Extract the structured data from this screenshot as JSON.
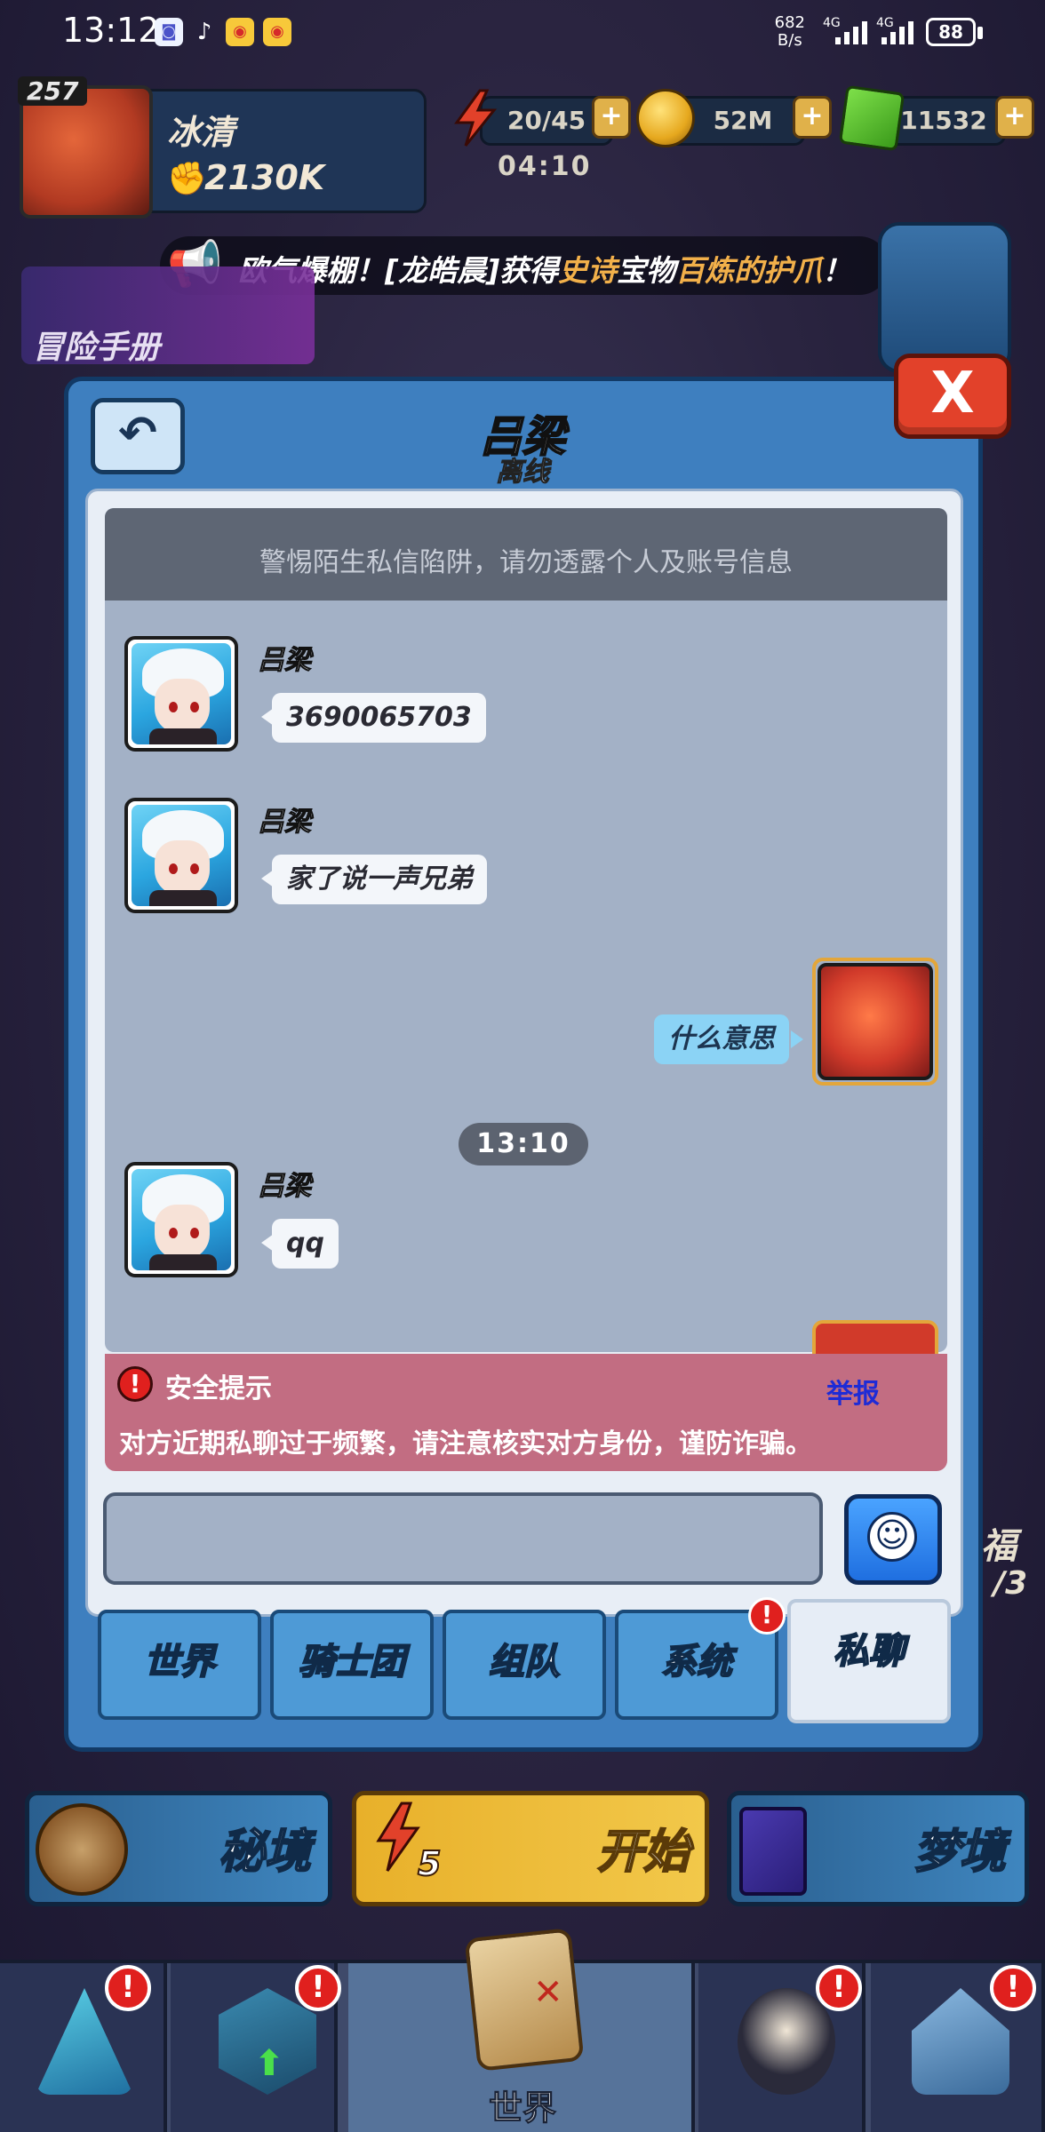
{
  "status_bar": {
    "time": "13:12",
    "net_speed_value": "682",
    "net_speed_unit": "B/s",
    "network_1": "4G",
    "network_2": "4G",
    "battery": "88"
  },
  "hud": {
    "level": "257",
    "player_name": "冰清",
    "power": "2130K",
    "energy": "20/45",
    "energy_timer": "04:10",
    "coins": "52M",
    "gems": "11532",
    "plus_label": "+"
  },
  "announcement": {
    "prefix": "欧气爆棚！[龙皓晨]获得",
    "rarity": "史诗",
    "middle": "宝物",
    "item": "百炼的护爪",
    "suffix": "！"
  },
  "side": {
    "adventure_label": "冒险手册",
    "bless_label": "福",
    "bless_count": "/3"
  },
  "chat": {
    "title": "吕梁",
    "subtitle": "离线",
    "close_label": "X",
    "back_label": "↶",
    "warning": "警惕陌生私信陷阱，请勿透露个人及账号信息",
    "messages": [
      {
        "sender": "吕梁",
        "text": "3690065703"
      },
      {
        "sender": "吕梁",
        "text": "家了说一声兄弟"
      },
      {
        "sender": "",
        "text": "什么意思"
      },
      {
        "sender": "吕梁",
        "text": "qq"
      }
    ],
    "time_divider": "13:10",
    "safety": {
      "icon": "!",
      "title": "安全提示",
      "report": "举报",
      "body": "对方近期私聊过于频繁，请注意核实对方身份，谨防诈骗。"
    },
    "input_placeholder": "",
    "tabs": [
      "世界",
      "骑士团",
      "组队",
      "系统",
      "私聊"
    ],
    "active_tab": "私聊",
    "tab_alert": "!"
  },
  "modes": {
    "secret": "秘境",
    "start": "开始",
    "start_cost": "5",
    "dream": "梦境"
  },
  "nav": {
    "active_label": "世界",
    "alert": "!"
  },
  "colors": {
    "modal_blue": "#3e7fbf",
    "chat_bg": "#a3b1c6",
    "safety_pink": "#c26d82",
    "alert_red": "#e0201e",
    "epic_orange": "#f2b04a"
  }
}
